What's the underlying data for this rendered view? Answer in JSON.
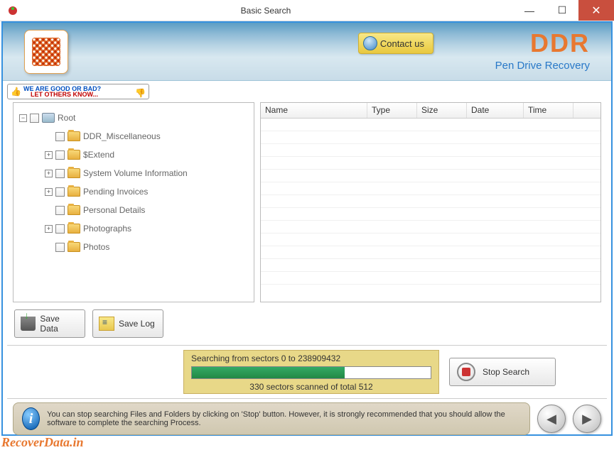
{
  "window": {
    "title": "Basic Search"
  },
  "branding": {
    "ddr": "DDR",
    "subtitle": "Pen Drive Recovery",
    "footer": "RecoverData.in"
  },
  "contact": {
    "label": "Contact us"
  },
  "banner": {
    "line1": "WE ARE GOOD OR BAD?",
    "line2": "LET OTHERS KNOW..."
  },
  "tree": {
    "root": "Root",
    "items": [
      {
        "label": "DDR_Miscellaneous",
        "expandable": false
      },
      {
        "label": "$Extend",
        "expandable": true
      },
      {
        "label": "System Volume Information",
        "expandable": true
      },
      {
        "label": "Pending Invoices",
        "expandable": true
      },
      {
        "label": "Personal Details",
        "expandable": false
      },
      {
        "label": "Photographs",
        "expandable": true
      },
      {
        "label": "Photos",
        "expandable": false
      }
    ]
  },
  "columns": {
    "name": "Name",
    "type": "Type",
    "size": "Size",
    "date": "Date",
    "time": "Time"
  },
  "buttons": {
    "save_data": "Save Data",
    "save_log": "Save Log",
    "stop": "Stop Search"
  },
  "progress": {
    "searching": "Searching from sectors 0 to 238909432",
    "status": "330  sectors scanned of total 512",
    "percent": 64
  },
  "info": {
    "text": "You can stop searching Files and Folders by clicking on 'Stop' button. However, it is strongly recommended that you should allow the software to complete the searching Process."
  }
}
